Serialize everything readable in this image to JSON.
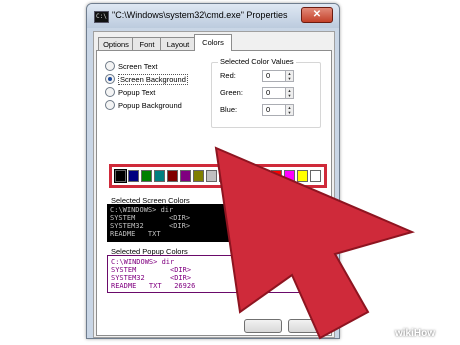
{
  "window": {
    "title": "\"C:\\Windows\\system32\\cmd.exe\" Properties",
    "sys_icon_text": "C:\\",
    "close_label": "✕"
  },
  "tabs": [
    {
      "label": "Options"
    },
    {
      "label": "Font"
    },
    {
      "label": "Layout"
    },
    {
      "label": "Colors",
      "active": true
    }
  ],
  "radios": [
    {
      "label": "Screen Text",
      "selected": false
    },
    {
      "label": "Screen Background",
      "selected": true
    },
    {
      "label": "Popup Text",
      "selected": false
    },
    {
      "label": "Popup Background",
      "selected": false
    }
  ],
  "color_values": {
    "group_label": "Selected Color Values",
    "red_label": "Red:",
    "red": "0",
    "green_label": "Green:",
    "green": "0",
    "blue_label": "Blue:",
    "blue": "0"
  },
  "palette": [
    "#000000",
    "#000080",
    "#008000",
    "#008080",
    "#800000",
    "#800080",
    "#808000",
    "#c0c0c0",
    "#808080",
    "#0000ff",
    "#00ff00",
    "#00ffff",
    "#ff0000",
    "#ff00ff",
    "#ffff00",
    "#ffffff"
  ],
  "screen_preview": {
    "label": "Selected Screen Colors",
    "lines": [
      "C:\\WINDOWS> dir",
      "SYSTEM        <DIR>",
      "SYSTEM32      <DIR>",
      "README   TXT"
    ],
    "fg": "#c0c0c0",
    "bg": "#000000"
  },
  "popup_preview": {
    "label": "Selected Popup Colors",
    "lines": [
      "C:\\WINDOWS> dir",
      "SYSTEM        <DIR>",
      "SYSTEM32      <DIR>",
      "README   TXT   26926"
    ],
    "fg": "#800080",
    "bg": "#ffffff"
  },
  "watermark": "wikiHow",
  "accent": "#cf2a3a"
}
